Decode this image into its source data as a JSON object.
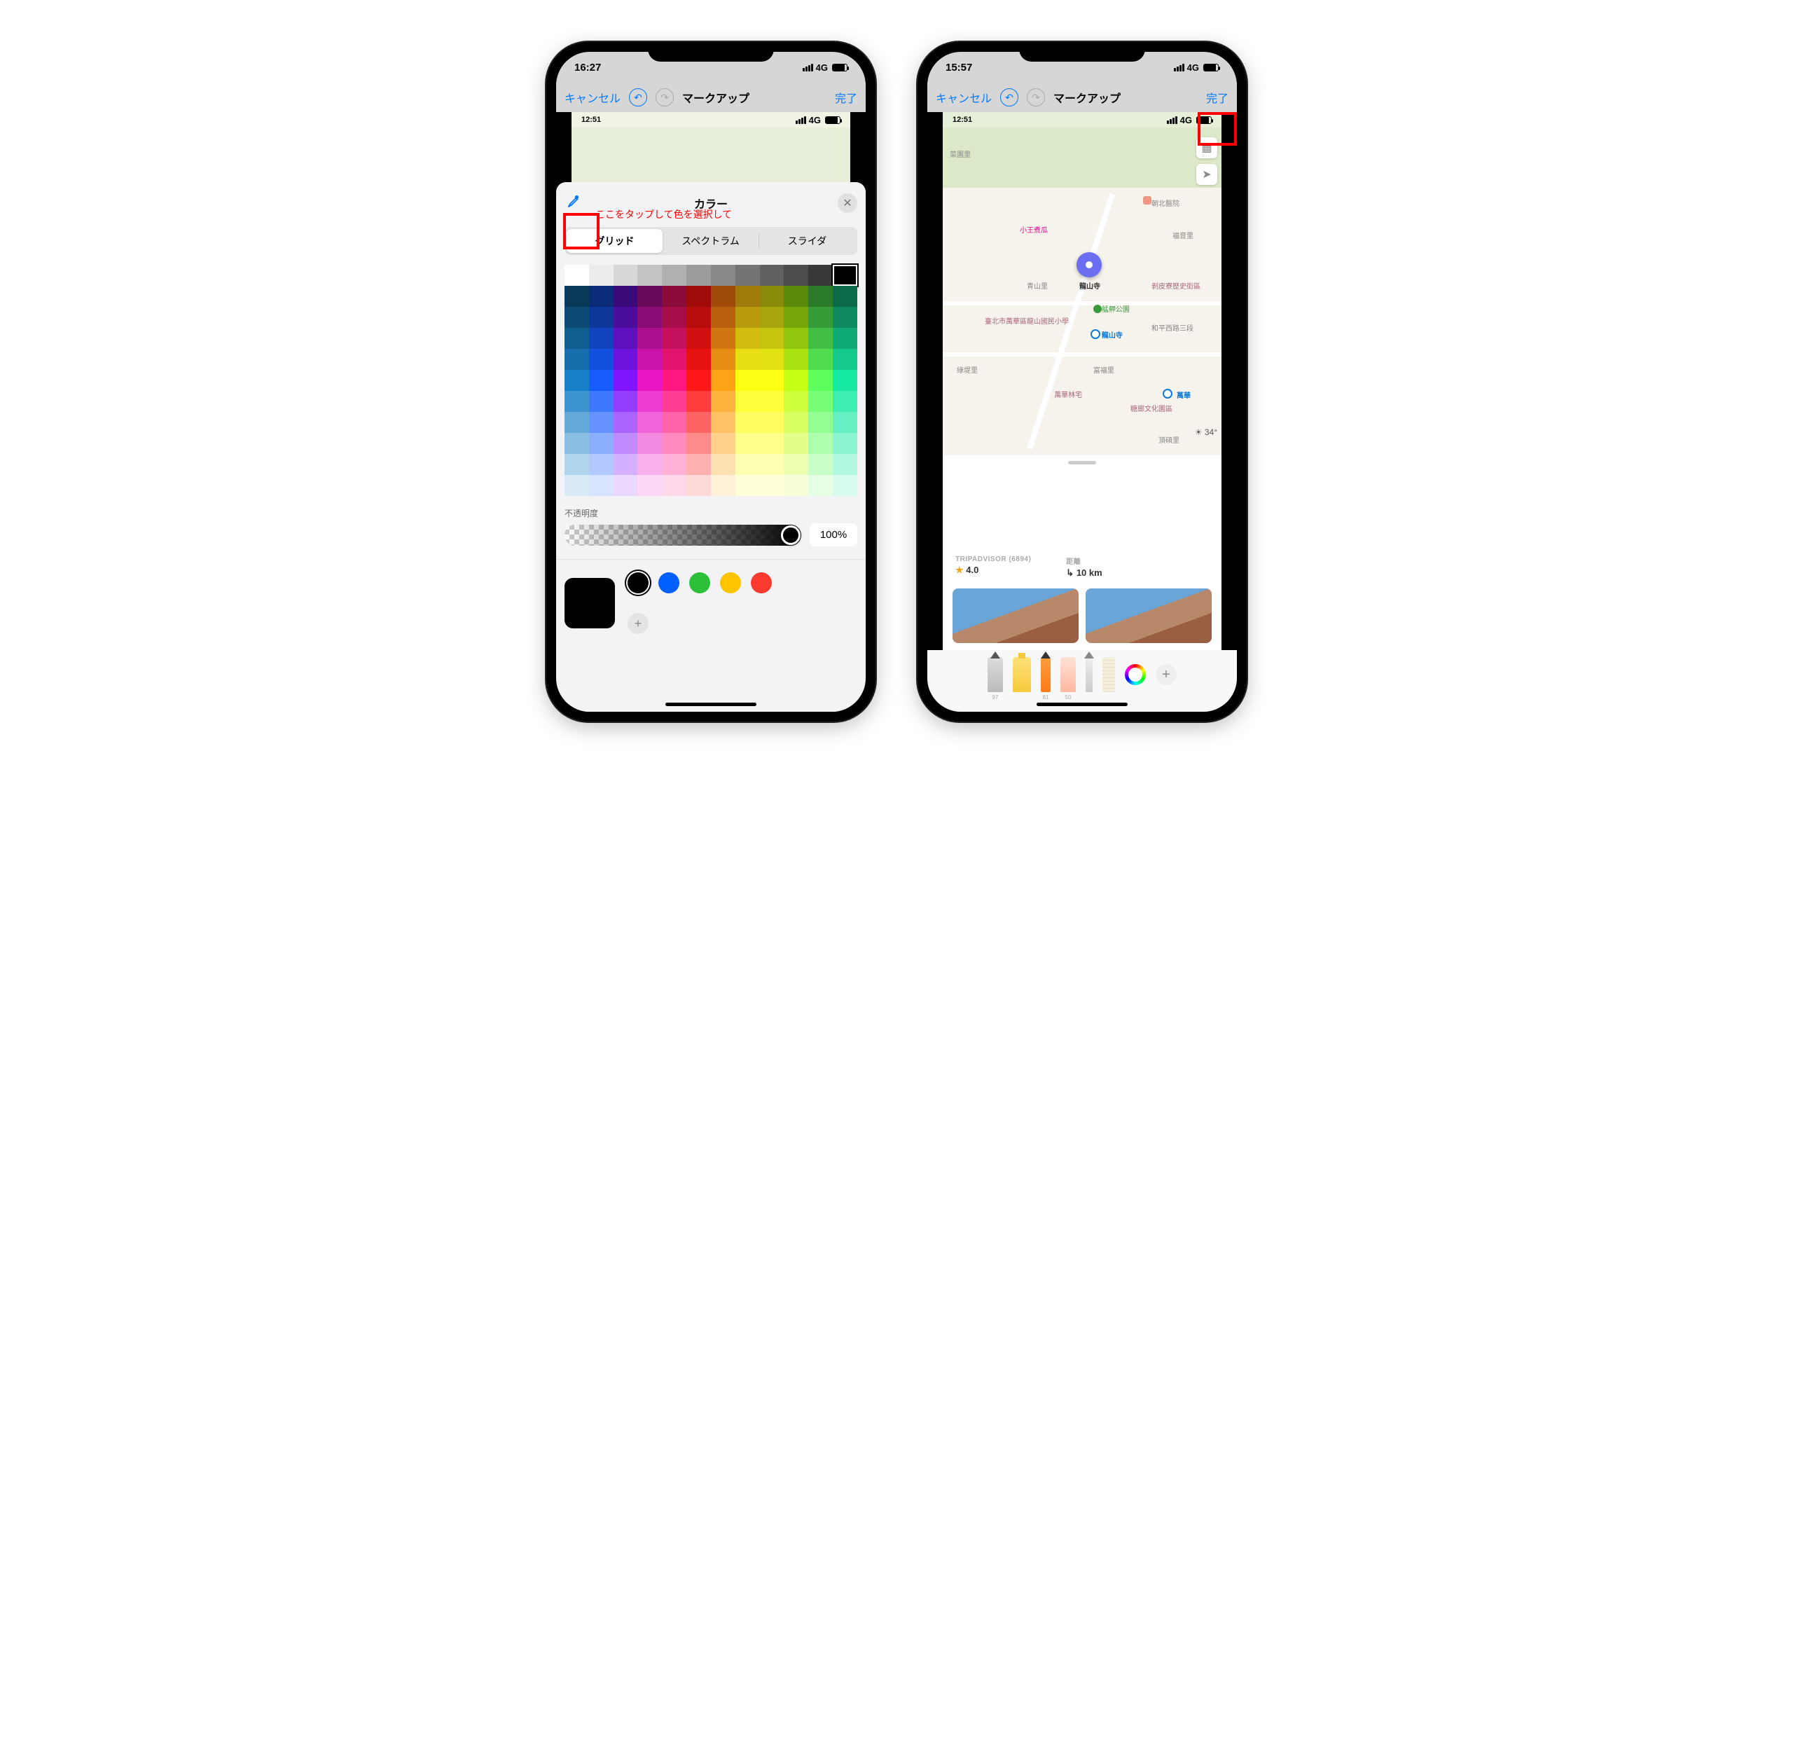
{
  "left": {
    "status": {
      "time": "16:27",
      "net": "4G"
    },
    "nav": {
      "cancel": "キャンセル",
      "title": "マークアップ",
      "done": "完了"
    },
    "inner": {
      "time": "12:51",
      "net": "4G"
    },
    "panel": {
      "title": "カラー",
      "hint": "ここをタップして色を選択して",
      "tabs": [
        "グリッド",
        "スペクトラム",
        "スライダ"
      ],
      "grays": [
        "#ffffff",
        "#ececec",
        "#d8d8d8",
        "#c4c4c4",
        "#b0b0b0",
        "#9c9c9c",
        "#888888",
        "#747474",
        "#606060",
        "#4c4c4c",
        "#383838",
        "#000000"
      ],
      "hues": [
        "#0a3a5a",
        "#0a2a7a",
        "#3a0a7a",
        "#6a0a5a",
        "#8a0a3a",
        "#a00a0a",
        "#a04a0a",
        "#a07a0a",
        "#8a8a0a",
        "#5a8a0a",
        "#2a7a2a",
        "#0a6a4a"
      ],
      "rows": 10,
      "opacity": {
        "label": "不透明度",
        "value": "100%"
      },
      "swatches": [
        "#000000",
        "#0060ff",
        "#2bbf3a",
        "#ffc400",
        "#ff3b30"
      ]
    }
  },
  "right": {
    "status": {
      "time": "15:57",
      "net": "4G"
    },
    "nav": {
      "cancel": "キャンセル",
      "title": "マークアップ",
      "done": "完了"
    },
    "inner": {
      "time": "12:51",
      "net": "4G"
    },
    "map": {
      "labels": {
        "northpark": "菜園里",
        "hospital": "朝北醫院",
        "shop": "小王煮瓜",
        "fuku": "福音里",
        "aoyama": "青山里",
        "temple": "龍山寺",
        "history": "剝皮寮歷史街區",
        "school": "臺北市萬華區龍山國民小學",
        "park": "艋舺公園",
        "road3": "和平西路三段",
        "station": "龍山寺",
        "green": "綠堤里",
        "rich": "富福里",
        "wanhualin": "萬華林宅",
        "wanhua": "萬華",
        "hall": "糖廍文化園區",
        "south": "頂碩里"
      },
      "weather": "☀ 34°"
    },
    "sheet": {
      "trip_label": "TRIPADVISOR (6894)",
      "rating": "4.0",
      "dist_label": "距離",
      "dist_value": "10 km"
    },
    "tools": [
      "97",
      "",
      "81",
      "50",
      "",
      ""
    ]
  }
}
